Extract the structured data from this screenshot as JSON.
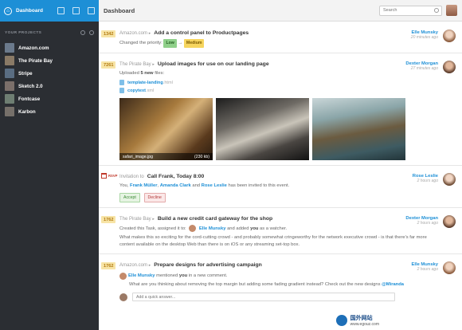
{
  "sidebar": {
    "app_title": "Dashboard",
    "section_label": "YOUR PROJECTS",
    "projects": [
      {
        "name": "Amazon.com",
        "color": "#6b7a8c"
      },
      {
        "name": "The Pirate Bay",
        "color": "#8a7a66"
      },
      {
        "name": "Stripe",
        "color": "#5a6d82"
      },
      {
        "name": "Sketch 2.0",
        "color": "#7b6f6a"
      },
      {
        "name": "Fontcase",
        "color": "#6e7e72"
      },
      {
        "name": "Karbon",
        "color": "#76706a"
      }
    ]
  },
  "header": {
    "title": "Dashboard",
    "search_placeholder": "Search"
  },
  "feed": [
    {
      "badge": "1342",
      "source": "Amazon.com",
      "title": "Add a control panel to Productpages",
      "user": "Elle Munsky",
      "time": "20 minutes ago",
      "text": "Changed the priority:",
      "from": "Low",
      "arrow": "→",
      "to": "Medium"
    },
    {
      "badge": "7261",
      "source": "The Pirate Bay",
      "title": "Upload images for use on our landing page",
      "user": "Dexter Morgan",
      "time": "27 minutes ago",
      "text_pre": "Uploaded",
      "count": "5 new",
      "text_post": "files:",
      "files": [
        {
          "name": "template-landing",
          "ext": ".html"
        },
        {
          "name": "copytext",
          "ext": ".xml"
        }
      ],
      "photo_caption": "safari_image.jpg",
      "photo_size": "(230 kb)"
    },
    {
      "rsvp": "RSVP",
      "source": "Invitation to",
      "title": "Call Frank, Today 8:00",
      "user": "Rose Leslie",
      "time": "2 hours ago",
      "you": "You,",
      "invitees": [
        "Frank Müller",
        "Amanda Clark",
        "Rose Leslie"
      ],
      "comma": ",",
      "and": "and",
      "text_post": "has been invited to this event.",
      "accept": "Accept",
      "decline": "Decline"
    },
    {
      "badge": "1762",
      "source": "The Pirate Bay",
      "title": "Build a new credit card gateway for the shop",
      "user": "Dexter Morgan",
      "time": "2 hours ago",
      "line1_pre": "Created this Task, assigned it to:",
      "assignee": "Elle Munsky",
      "line1_mid": "and added",
      "line1_you": "you",
      "line1_post": "as a watcher.",
      "description": "What makes this so exciting for the cord-cutting crowd - and probably somewhat cringeworthy for the network executive crowd - is that there's far more content available on the desktop Web than there is on iOS or any streaming set-top box."
    },
    {
      "badge": "1762",
      "source": "Amazon.com",
      "title": "Prepare designs for advertising campaign",
      "user": "Elle Munsky",
      "time": "2 hours ago",
      "commenter": "Elle Munsky",
      "mention_pre": "mentioned",
      "mention_you": "you",
      "mention_post": "in a new comment.",
      "comment_pre": "What are you thinking about removing the top margin but adding some fading gradient instead? Check out the new designs",
      "comment_mention": "@Miranda",
      "reply_placeholder": "Add a quick answer..."
    }
  ],
  "watermark": {
    "line1": "国外网站",
    "line2": "www.egouz.com"
  }
}
